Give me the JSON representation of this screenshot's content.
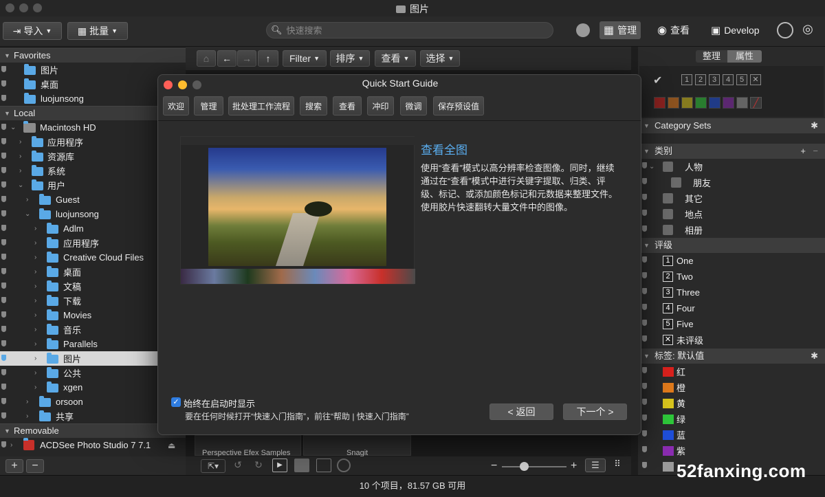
{
  "window": {
    "title": "图片"
  },
  "toolbar": {
    "import_label": "导入",
    "batch_label": "批量",
    "search_placeholder": "快速搜索",
    "modes": [
      "管理",
      "查看",
      "Develop"
    ]
  },
  "sidebar": {
    "favorites_header": "Favorites",
    "favorites": [
      "图片",
      "桌面",
      "luojunsong"
    ],
    "local_header": "Local",
    "local": [
      "Macintosh HD",
      "应用程序",
      "资源库",
      "系统",
      "用户",
      "Guest",
      "luojunsong",
      "Adlm",
      "应用程序",
      "Creative Cloud Files",
      "桌面",
      "文稿",
      "下载",
      "Movies",
      "音乐",
      "Parallels",
      "图片",
      "公共",
      "xgen",
      "orsoon",
      "共享"
    ],
    "removable_header": "Removable",
    "removable": [
      "ACDSee Photo Studio 7 7.1"
    ],
    "add_label": "+",
    "remove_label": "−"
  },
  "navbar": {
    "filter_label": "Filter",
    "sort_label": "排序",
    "view_label": "查看",
    "select_label": "选择"
  },
  "center": {
    "thumb_labels": [
      "Perspective Efex Samples",
      "Snagit"
    ]
  },
  "right_panel": {
    "tabs": [
      "整理",
      "属性"
    ],
    "category_sets_label": "Category Sets",
    "categories_header": "类别",
    "categories": [
      "人物",
      "朋友",
      "其它",
      "地点",
      "相册"
    ],
    "ratings_header": "评级",
    "ratings": [
      {
        "num": "1",
        "label": "One"
      },
      {
        "num": "2",
        "label": "Two"
      },
      {
        "num": "3",
        "label": "Three"
      },
      {
        "num": "4",
        "label": "Four"
      },
      {
        "num": "5",
        "label": "Five"
      },
      {
        "num": "✕",
        "label": "未评级"
      }
    ],
    "labels_header": "标签: 默认值",
    "color_labels": [
      {
        "name": "红",
        "color": "#d9211d"
      },
      {
        "name": "橙",
        "color": "#e07a1c"
      },
      {
        "name": "黄",
        "color": "#d8c41d"
      },
      {
        "name": "绿",
        "color": "#2ec73a"
      },
      {
        "name": "蓝",
        "color": "#1f4fd9"
      },
      {
        "name": "紫",
        "color": "#8a2cb0"
      },
      {
        "name": "",
        "color": "#9a9a9a"
      }
    ],
    "rating_numbers": [
      "1",
      "2",
      "3",
      "4",
      "5",
      "✕"
    ]
  },
  "status": {
    "text": "10 个项目，81.57 GB 可用"
  },
  "dialog": {
    "title": "Quick Start Guide",
    "tabs": [
      "欢迎",
      "管理",
      "批处理工作流程",
      "搜索",
      "查看",
      "冲印",
      "微调",
      "保存预设值"
    ],
    "heading": "查看全图",
    "body": "使用“查看”模式以高分辨率检查图像。同时，继续通过在“查看”模式中进行关键字提取、归类、评级、标记、或添加颜色标记和元数据来整理文件。使用胶片快速翻转大量文件中的图像。",
    "checkbox_label": "始终在启动时显示",
    "hint": "要在任何时候打开“快速入门指南”，前往“帮助 | 快速入门指南”",
    "back_label": "< 返回",
    "next_label": "下一个 >"
  },
  "watermark": "52fanxing.com"
}
